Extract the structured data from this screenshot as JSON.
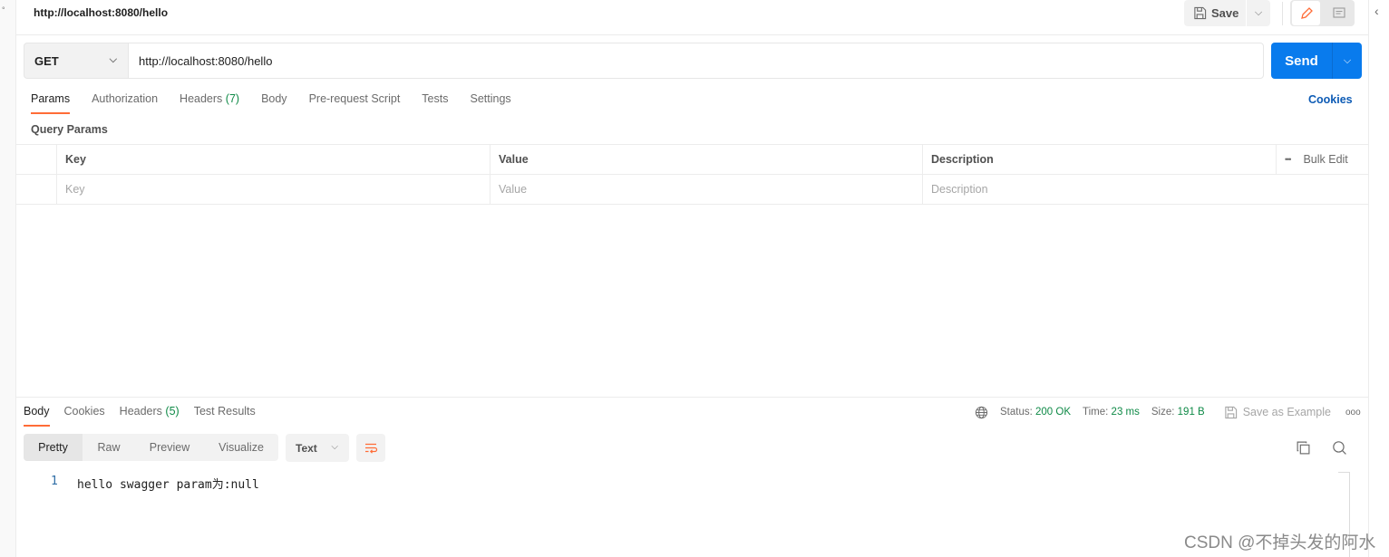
{
  "request": {
    "title": "http://localhost:8080/hello",
    "method": "GET",
    "url": "http://localhost:8080/hello"
  },
  "toolbar": {
    "save_label": "Save",
    "send_label": "Send"
  },
  "request_tabs": [
    {
      "label": "Params",
      "active": true
    },
    {
      "label": "Authorization"
    },
    {
      "label": "Headers",
      "count": "(7)"
    },
    {
      "label": "Body"
    },
    {
      "label": "Pre-request Script"
    },
    {
      "label": "Tests"
    },
    {
      "label": "Settings"
    }
  ],
  "cookies_link": "Cookies",
  "query_params": {
    "title": "Query Params",
    "columns": [
      "Key",
      "Value",
      "Description"
    ],
    "bulk_edit": "Bulk Edit",
    "more": "•••",
    "placeholders": {
      "key": "Key",
      "value": "Value",
      "description": "Description"
    }
  },
  "response_tabs": [
    {
      "label": "Body",
      "active": true
    },
    {
      "label": "Cookies"
    },
    {
      "label": "Headers",
      "count": "(5)"
    },
    {
      "label": "Test Results"
    }
  ],
  "response_meta": {
    "status_label": "Status:",
    "status_value": "200 OK",
    "time_label": "Time:",
    "time_value": "23 ms",
    "size_label": "Size:",
    "size_value": "191 B",
    "save_example": "Save as Example",
    "more": "ooo"
  },
  "view_modes": [
    "Pretty",
    "Raw",
    "Preview",
    "Visualize"
  ],
  "format": "Text",
  "response_body": [
    {
      "line": "1",
      "text": "hello swagger param为:null"
    }
  ],
  "watermark": "CSDN @不掉头发的阿水",
  "colors": {
    "accent": "#ff6c37",
    "primary": "#097bed",
    "success": "#0f8a47",
    "link": "#0d5bb5"
  }
}
